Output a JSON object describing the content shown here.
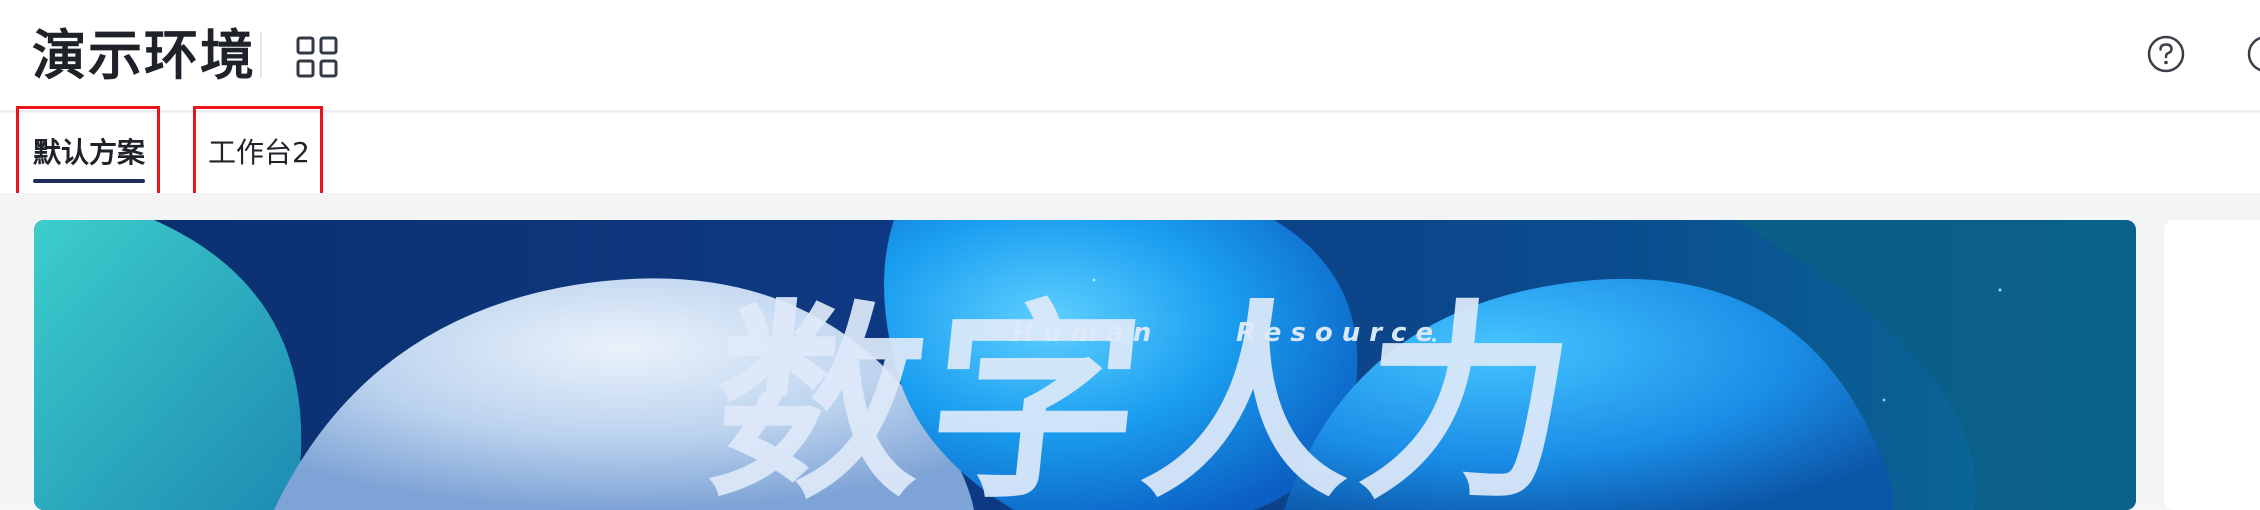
{
  "header": {
    "title": "演示环境",
    "apps_icon": "grid-apps-icon",
    "help_icon": "help-circle-icon",
    "edge_icon": "partial-circle-icon"
  },
  "tabs": [
    {
      "label": "默认方案",
      "active": true
    },
    {
      "label": "工作台2",
      "active": false
    }
  ],
  "banner": {
    "headline": "数字人力",
    "subtitle_left": "Human",
    "subtitle_right": "Resource"
  },
  "colors": {
    "accent_underline": "#1f2d5a",
    "highlight_box": "#e8161b",
    "banner_deep": "#0b2a66",
    "banner_bright": "#1aa3f0"
  }
}
